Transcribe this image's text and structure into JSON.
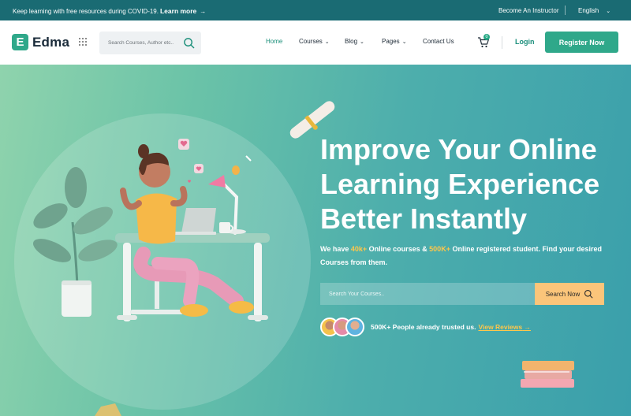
{
  "topbar": {
    "promo_text": "Keep learning with free resources during COVID-19.",
    "promo_link": "Learn more",
    "promo_arrow": "→",
    "instructor": "Become An Instructor",
    "language": "English",
    "language_caret": "⌄"
  },
  "header": {
    "logo_letter": "E",
    "logo_text": "Edma",
    "search_placeholder": "Search Courses, Author etc..",
    "nav": [
      {
        "label": "Home",
        "caret": ""
      },
      {
        "label": "Courses",
        "caret": "⌄"
      },
      {
        "label": "Blog",
        "caret": "⌄"
      },
      {
        "label": "Pages",
        "caret": "⌄"
      },
      {
        "label": "Contact Us",
        "caret": ""
      }
    ],
    "cart_count": "0",
    "login": "Login",
    "register": "Register Now"
  },
  "hero": {
    "headline": [
      "Improve Your Online",
      "Learning Experience",
      "Better Instantly"
    ],
    "sub_1": "We have ",
    "sub_courses": "40k+",
    "sub_2": " Online courses & ",
    "sub_students": "500K+",
    "sub_3": " Online registered student. Find your desired Courses from them.",
    "search_placeholder": "Search Your Courses..",
    "search_button": "Search Now",
    "trust_text": "500K+ People already trusted us.",
    "trust_link": "View Reviews",
    "trust_arrow": "→"
  },
  "colors": {
    "topbar": "#1a6b73",
    "brand_green": "#2fa88a",
    "highlight_yellow": "#ffc74a",
    "search_button": "#fbc57a"
  },
  "icons": [
    "grid-menu-icon",
    "search-icon",
    "cart-icon",
    "arrow-right-icon"
  ]
}
